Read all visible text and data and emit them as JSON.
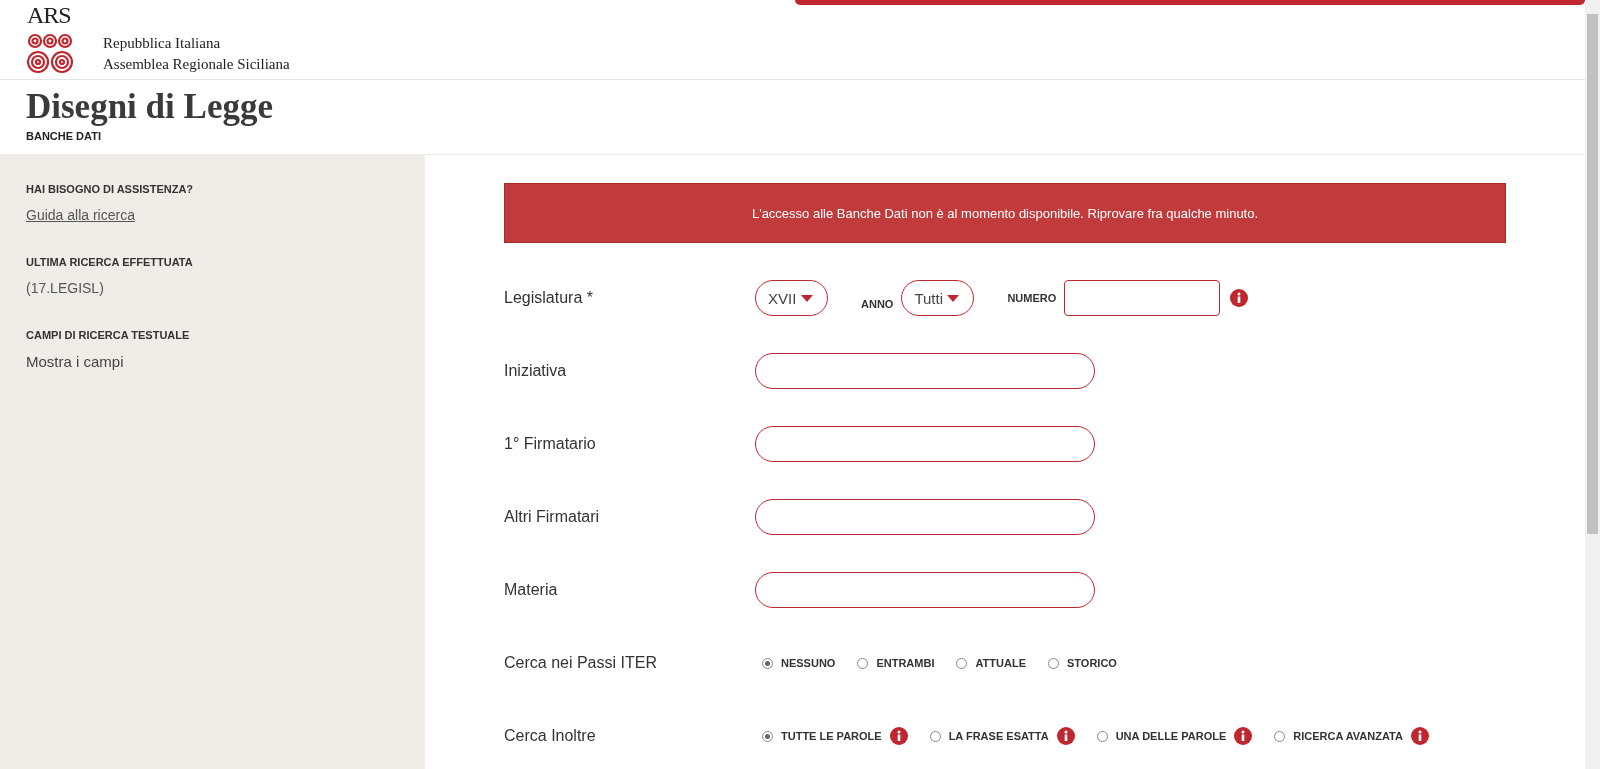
{
  "header": {
    "logo_text": "ARS",
    "lines": [
      "Repubblica Italiana",
      "Assemblea Regionale Siciliana"
    ]
  },
  "page_title": "Disegni di Legge",
  "page_subtitle": "BANCHE DATI",
  "sidebar": {
    "sections": [
      {
        "heading": "HAI BISOGNO DI ASSISTENZA?",
        "item": "Guida alla ricerca",
        "kind": "link"
      },
      {
        "heading": "ULTIMA RICERCA EFFETTUATA",
        "item": "(17.LEGISL)",
        "kind": "text"
      },
      {
        "heading": "CAMPI DI RICERCA TESTUALE",
        "item": "Mostra i campi",
        "kind": "action"
      }
    ]
  },
  "alert": "L'accesso alle Banche Dati non è al momento disponibile. Riprovare fra qualche minuto.",
  "form": {
    "rows": [
      {
        "kind": "group",
        "label": "Legislatura *",
        "controls": [
          {
            "kind": "select",
            "value": "XVII"
          },
          {
            "kind": "select",
            "label": "ANNO",
            "value": "Tutti"
          },
          {
            "kind": "input",
            "label": "NUMERO",
            "info": true
          }
        ]
      },
      {
        "kind": "text",
        "label": "Iniziativa"
      },
      {
        "kind": "text",
        "label": "1° Firmatario"
      },
      {
        "kind": "text",
        "label": "Altri Firmatari"
      },
      {
        "kind": "text",
        "label": "Materia"
      },
      {
        "kind": "radio",
        "label": "Cerca nei Passi ITER",
        "options": [
          {
            "label": "NESSUNO",
            "selected": true,
            "info": false
          },
          {
            "label": "ENTRAMBI",
            "selected": false,
            "info": false
          },
          {
            "label": "ATTUALE",
            "selected": false,
            "info": false
          },
          {
            "label": "STORICO",
            "selected": false,
            "info": false
          }
        ]
      },
      {
        "kind": "radio",
        "label": "Cerca Inoltre",
        "options": [
          {
            "label": "TUTTE LE PAROLE",
            "selected": true,
            "info": true
          },
          {
            "label": "LA FRASE ESATTA",
            "selected": false,
            "info": true
          },
          {
            "label": "UNA DELLE PAROLE",
            "selected": false,
            "info": true
          },
          {
            "label": "RICERCA AVANZATA",
            "selected": false,
            "info": true
          }
        ]
      }
    ]
  }
}
